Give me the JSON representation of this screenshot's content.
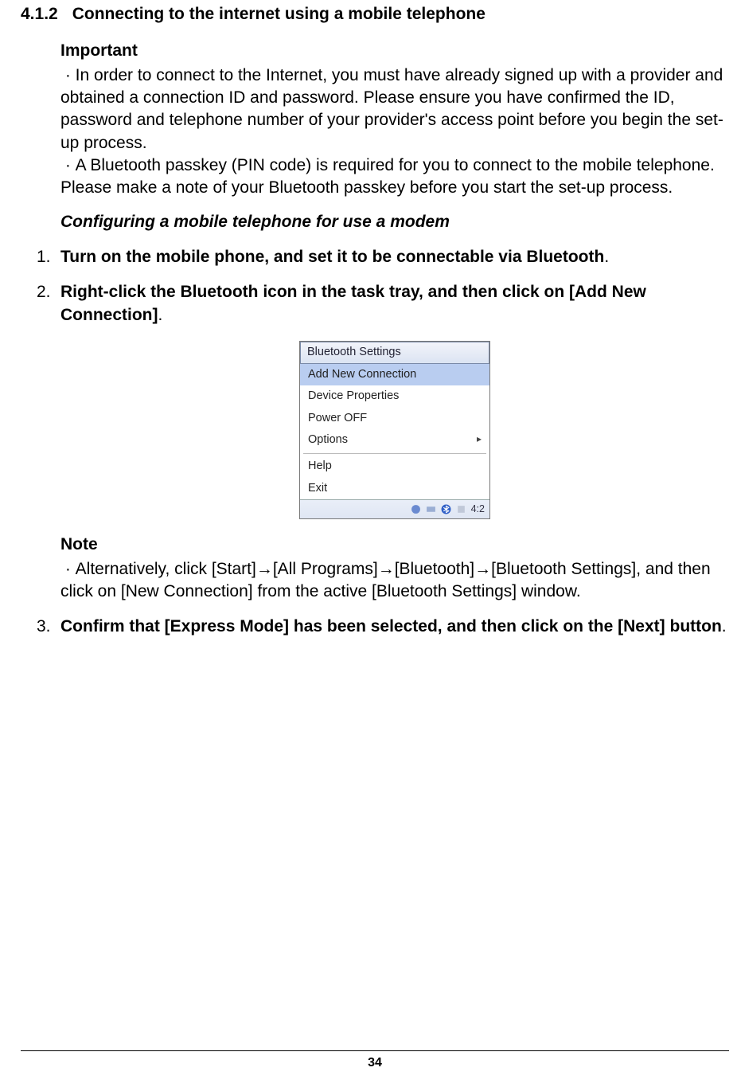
{
  "heading": {
    "number": "4.1.2",
    "title": "Connecting to the internet using a mobile telephone"
  },
  "important": {
    "label": "Important",
    "bullets": [
      "In order to connect to the Internet, you must have already signed up with a provider and obtained a connection ID and password. Please ensure you have confirmed the ID, password and telephone number of your provider's access point before you begin the set-up process.",
      "A Bluetooth passkey (PIN code) is required for you to connect to the mobile telephone. Please make a note of your Bluetooth passkey before you start the set-up process."
    ]
  },
  "configuring_heading": "Configuring a mobile telephone for use a modem",
  "steps": [
    {
      "num": "1.",
      "bold": "Turn on the mobile phone, and set it to be connectable via Bluetooth",
      "tail": "."
    },
    {
      "num": "2.",
      "bold": "Right-click the Bluetooth icon in the task tray, and then click on [Add New Connection]",
      "tail": "."
    },
    {
      "num": "3.",
      "bold": "Confirm that [Express Mode] has been selected, and then click on the [Next] button",
      "tail": "."
    }
  ],
  "context_menu": {
    "header": "Bluetooth Settings",
    "items": {
      "add_new": "Add New Connection",
      "device_props": "Device Properties",
      "power_off": "Power OFF",
      "options": "Options",
      "help": "Help",
      "exit": "Exit"
    },
    "tray_time": "4:2"
  },
  "note": {
    "label": "Note",
    "text": "Alternatively, click [Start]→[All Programs]→[Bluetooth]→[Bluetooth Settings], and then click on [New Connection] from the active [Bluetooth Settings] window."
  },
  "page_number": "34"
}
